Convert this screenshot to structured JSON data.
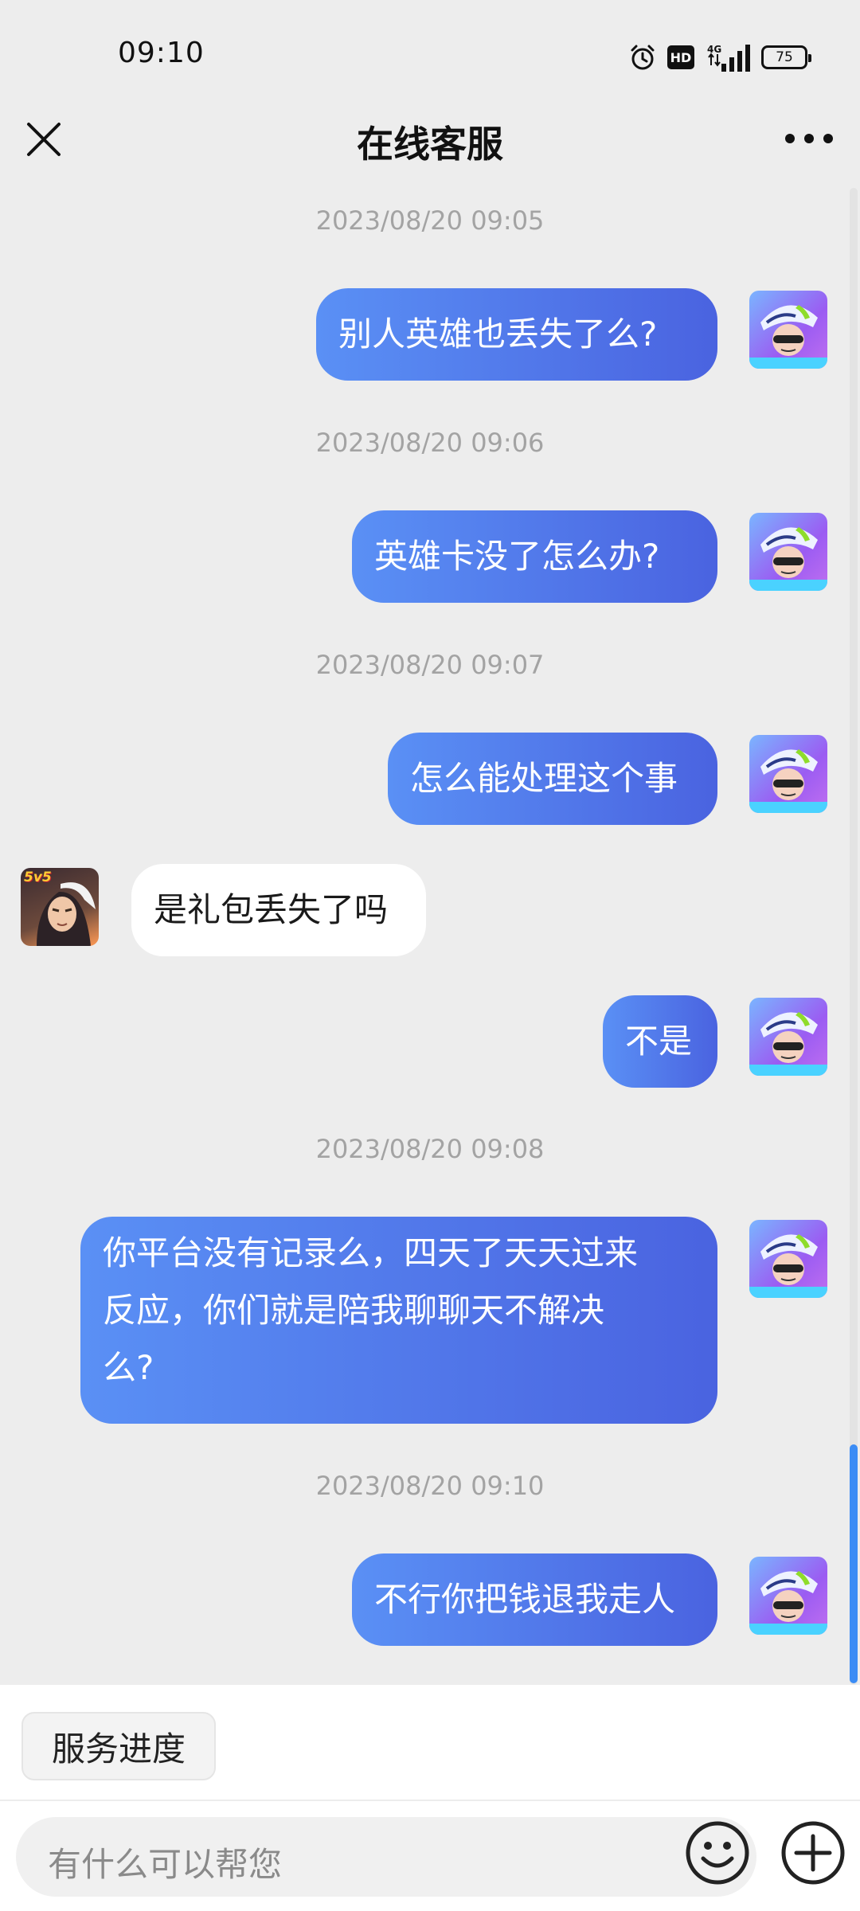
{
  "status_bar": {
    "time": "09:10",
    "battery": "75",
    "network": "4G",
    "hd_badge": "HD",
    "icons": [
      "alarm-icon",
      "hd-icon",
      "signal-icon",
      "battery-icon"
    ]
  },
  "nav": {
    "title": "在线客服",
    "close_icon": "close-icon",
    "more_icon": "more-icon"
  },
  "messages": [
    {
      "type": "timestamp",
      "text": "2023/08/20 09:05"
    },
    {
      "type": "outgoing",
      "text": "别人英雄也丢失了么?"
    },
    {
      "type": "timestamp",
      "text": "2023/08/20 09:06"
    },
    {
      "type": "outgoing",
      "text": "英雄卡没了怎么办?"
    },
    {
      "type": "timestamp",
      "text": "2023/08/20 09:07"
    },
    {
      "type": "outgoing",
      "text": "怎么能处理这个事"
    },
    {
      "type": "incoming",
      "text": "是礼包丢失了吗"
    },
    {
      "type": "outgoing",
      "text": "不是"
    },
    {
      "type": "timestamp",
      "text": "2023/08/20 09:08"
    },
    {
      "type": "outgoing",
      "lines": [
        "你平台没有记录么，四天了天天过来",
        "反应，你们就是陪我聊聊天不解决",
        "么?"
      ]
    },
    {
      "type": "timestamp",
      "text": "2023/08/20 09:10"
    },
    {
      "type": "outgoing",
      "text": "不行你把钱退我走人"
    }
  ],
  "bot_avatar": {
    "badge": "5v5"
  },
  "bottom": {
    "service_button": "服务进度",
    "input_placeholder": "有什么可以帮您",
    "emoji_icon": "emoji-icon",
    "plus_icon": "plus-icon"
  },
  "colors": {
    "background": "#ededed",
    "outgoing_bubble_start": "#5a90f5",
    "outgoing_bubble_end": "#4a63e0",
    "incoming_bubble": "#ffffff",
    "timestamp": "#a3a3a3",
    "scroll_thumb": "#3b8cf5"
  }
}
